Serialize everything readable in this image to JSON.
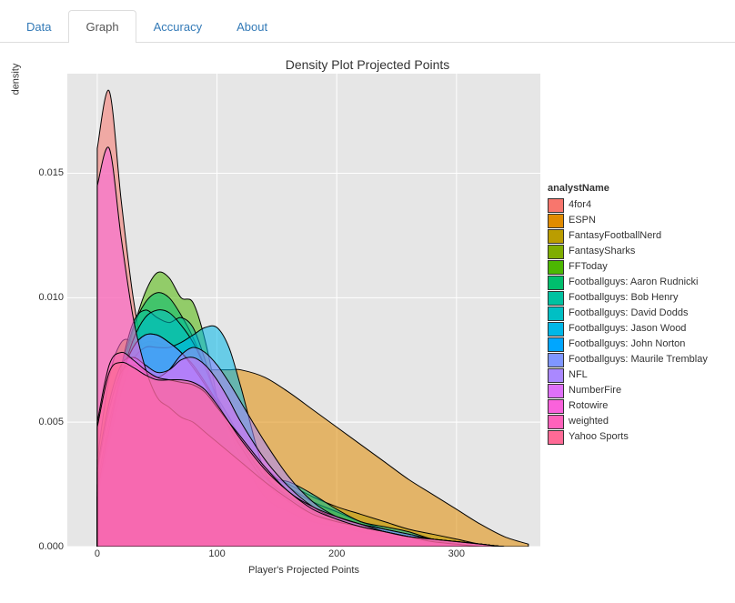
{
  "tabs": {
    "data": "Data",
    "graph": "Graph",
    "accuracy": "Accuracy",
    "about": "About"
  },
  "active_tab": "graph",
  "chart_data": {
    "type": "area",
    "title": "Density Plot Projected Points",
    "xlabel": "Player's Projected Points",
    "ylabel": "density",
    "xlim": [
      -25,
      370
    ],
    "ylim": [
      0,
      0.019
    ],
    "x_ticks": [
      0,
      100,
      200,
      300
    ],
    "y_ticks": [
      0.0,
      0.005,
      0.01,
      0.015
    ],
    "legend_title": "analystName",
    "x": [
      0,
      10,
      20,
      30,
      40,
      50,
      60,
      70,
      80,
      90,
      100,
      110,
      120,
      140,
      160,
      180,
      200,
      220,
      240,
      260,
      280,
      300,
      320,
      340,
      360
    ],
    "series": [
      {
        "name": "4for4",
        "color": "#f8766d",
        "values": [
          0.016,
          0.0183,
          0.0139,
          0.01,
          0.0075,
          0.0062,
          0.0056,
          0.0052,
          0.0048,
          0.0041,
          0.0035,
          0.003,
          0.0025,
          0.0016,
          0.001,
          0.0006,
          0.0005,
          0.0004,
          0.0003,
          0.0002,
          0.0001,
          0.0001,
          0.0,
          0.0,
          0.0
        ]
      },
      {
        "name": "ESPN",
        "color": "#e08b00",
        "values": [
          0.0025,
          0.004,
          0.0052,
          0.006,
          0.0064,
          0.0067,
          0.0068,
          0.0069,
          0.007,
          0.0071,
          0.0071,
          0.0071,
          0.0071,
          0.0068,
          0.0062,
          0.0055,
          0.0048,
          0.0041,
          0.0034,
          0.0027,
          0.0021,
          0.0015,
          0.0009,
          0.0004,
          0.0001
        ]
      },
      {
        "name": "FantasyFootballNerd",
        "color": "#bb9d00",
        "values": [
          0.0035,
          0.0068,
          0.0082,
          0.0082,
          0.0076,
          0.0069,
          0.0064,
          0.0059,
          0.0054,
          0.005,
          0.0046,
          0.0042,
          0.0038,
          0.003,
          0.0025,
          0.002,
          0.0016,
          0.0013,
          0.001,
          0.0007,
          0.0005,
          0.0003,
          0.0001,
          0.0,
          0.0
        ]
      },
      {
        "name": "FantasySharks",
        "color": "#7fad00",
        "values": [
          0.0025,
          0.005,
          0.0068,
          0.0078,
          0.0082,
          0.0082,
          0.008,
          0.0076,
          0.0072,
          0.0066,
          0.006,
          0.0052,
          0.0044,
          0.0032,
          0.0024,
          0.0018,
          0.0014,
          0.001,
          0.0007,
          0.0005,
          0.0003,
          0.0002,
          0.0001,
          0.0,
          0.0
        ]
      },
      {
        "name": "FFToday",
        "color": "#4cb702",
        "values": [
          0.002,
          0.0043,
          0.0067,
          0.0087,
          0.0102,
          0.011,
          0.0108,
          0.01,
          0.0098,
          0.0083,
          0.006,
          0.0036,
          0.0022,
          0.0013,
          0.0008,
          0.0006,
          0.0005,
          0.0004,
          0.0003,
          0.0002,
          0.0001,
          0.0,
          0.0,
          0.0,
          0.0
        ]
      },
      {
        "name": "Footballguys: Aaron Rudnicki",
        "color": "#00be6d",
        "values": [
          0.002,
          0.0045,
          0.007,
          0.0088,
          0.0098,
          0.0102,
          0.01,
          0.0093,
          0.0084,
          0.0072,
          0.0058,
          0.0044,
          0.0031,
          0.0016,
          0.0011,
          0.0009,
          0.0007,
          0.0005,
          0.0004,
          0.0002,
          0.0001,
          0.0001,
          0.0,
          0.0,
          0.0
        ]
      },
      {
        "name": "Footballguys: Bob Henry",
        "color": "#00c1a1",
        "values": [
          0.002,
          0.0045,
          0.0072,
          0.009,
          0.0095,
          0.0092,
          0.009,
          0.0092,
          0.0088,
          0.0075,
          0.0058,
          0.0043,
          0.0034,
          0.0028,
          0.0026,
          0.0021,
          0.0015,
          0.001,
          0.0008,
          0.0006,
          0.0003,
          0.0002,
          0.0001,
          0.0,
          0.0
        ]
      },
      {
        "name": "Footballguys: David Dodds",
        "color": "#00bfc4",
        "values": [
          0.002,
          0.0044,
          0.0067,
          0.0083,
          0.0092,
          0.0095,
          0.0094,
          0.0089,
          0.0082,
          0.0072,
          0.006,
          0.0047,
          0.0036,
          0.002,
          0.0014,
          0.001,
          0.0008,
          0.0006,
          0.0004,
          0.0003,
          0.0002,
          0.0001,
          0.0,
          0.0,
          0.0
        ]
      },
      {
        "name": "Footballguys: Jason Wood",
        "color": "#00b7e7",
        "values": [
          0.002,
          0.0042,
          0.0062,
          0.0075,
          0.008,
          0.008,
          0.008,
          0.0082,
          0.0085,
          0.0088,
          0.0088,
          0.008,
          0.0064,
          0.003,
          0.002,
          0.0015,
          0.0012,
          0.0009,
          0.0007,
          0.0005,
          0.0003,
          0.0002,
          0.0001,
          0.0,
          0.0
        ]
      },
      {
        "name": "Footballguys: John Norton",
        "color": "#00a6ff",
        "values": [
          0.0022,
          0.0047,
          0.0068,
          0.008,
          0.0085,
          0.0085,
          0.0082,
          0.0078,
          0.0073,
          0.0066,
          0.0058,
          0.005,
          0.0042,
          0.0028,
          0.002,
          0.0014,
          0.001,
          0.0008,
          0.0006,
          0.0004,
          0.0002,
          0.0001,
          0.0,
          0.0,
          0.0
        ]
      },
      {
        "name": "Footballguys: Maurile Tremblay",
        "color": "#7f96ff",
        "values": [
          0.0022,
          0.0047,
          0.0068,
          0.008,
          0.0085,
          0.0085,
          0.0082,
          0.0078,
          0.0072,
          0.0065,
          0.0057,
          0.0048,
          0.004,
          0.0026,
          0.0018,
          0.0013,
          0.001,
          0.0008,
          0.0006,
          0.0004,
          0.0002,
          0.0001,
          0.0,
          0.0,
          0.0
        ]
      },
      {
        "name": "NFL",
        "color": "#aa88ff",
        "values": [
          0.003,
          0.0055,
          0.007,
          0.0073,
          0.007,
          0.0068,
          0.0071,
          0.0077,
          0.008,
          0.0078,
          0.0073,
          0.0066,
          0.0058,
          0.0042,
          0.0028,
          0.0018,
          0.0012,
          0.0009,
          0.0007,
          0.0005,
          0.0003,
          0.0002,
          0.0001,
          0.0,
          0.0
        ]
      },
      {
        "name": "NumberFire",
        "color": "#df70f8",
        "values": [
          0.0032,
          0.0058,
          0.0073,
          0.0076,
          0.0073,
          0.007,
          0.0071,
          0.0075,
          0.0076,
          0.0073,
          0.0067,
          0.0059,
          0.005,
          0.0035,
          0.0024,
          0.0016,
          0.0011,
          0.0008,
          0.0006,
          0.0004,
          0.0003,
          0.0002,
          0.0001,
          0.0,
          0.0
        ]
      },
      {
        "name": "Rotowire",
        "color": "#fa62db",
        "values": [
          0.0145,
          0.016,
          0.0124,
          0.0092,
          0.0072,
          0.006,
          0.0056,
          0.0052,
          0.005,
          0.0046,
          0.0042,
          0.0038,
          0.0034,
          0.0026,
          0.0019,
          0.0013,
          0.001,
          0.0008,
          0.0006,
          0.0004,
          0.0002,
          0.0001,
          0.0,
          0.0,
          0.0
        ]
      },
      {
        "name": "weighted",
        "color": "#ff62bb",
        "values": [
          0.005,
          0.0073,
          0.0078,
          0.0075,
          0.0071,
          0.0068,
          0.0067,
          0.0066,
          0.0065,
          0.0062,
          0.0056,
          0.005,
          0.0044,
          0.0032,
          0.0022,
          0.0016,
          0.0012,
          0.0009,
          0.0006,
          0.0004,
          0.0003,
          0.0002,
          0.0001,
          0.0,
          0.0
        ]
      },
      {
        "name": "Yahoo Sports",
        "color": "#ff6a96",
        "values": [
          0.0048,
          0.007,
          0.0074,
          0.0072,
          0.0069,
          0.0067,
          0.0067,
          0.0067,
          0.0066,
          0.0063,
          0.0057,
          0.005,
          0.0043,
          0.0031,
          0.0022,
          0.0015,
          0.0011,
          0.0008,
          0.0006,
          0.0004,
          0.0003,
          0.0002,
          0.0001,
          0.0,
          0.0
        ]
      }
    ]
  }
}
